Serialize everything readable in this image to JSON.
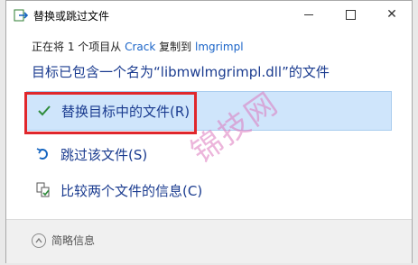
{
  "window": {
    "title": "替换或跳过文件"
  },
  "status": {
    "prefix": "正在将 1 个项目从",
    "source": "Crack",
    "middle": "复制到",
    "destination": "lmgrimpl"
  },
  "heading": "目标已包含一个名为“libmwlmgrimpl.dll”的文件",
  "options": [
    {
      "label": "替换目标中的文件(R)",
      "icon": "checkmark-icon"
    },
    {
      "label": "跳过该文件(S)",
      "icon": "skip-icon"
    },
    {
      "label": "比较两个文件的信息(C)",
      "icon": "compare-icon"
    }
  ],
  "footer": {
    "details_label": "简略信息"
  },
  "watermark": "锦技网",
  "colors": {
    "accent": "#1a3b8f",
    "link": "#1a64c8",
    "selected_bg": "#cfe5fb",
    "highlight_box": "#e0272c"
  }
}
